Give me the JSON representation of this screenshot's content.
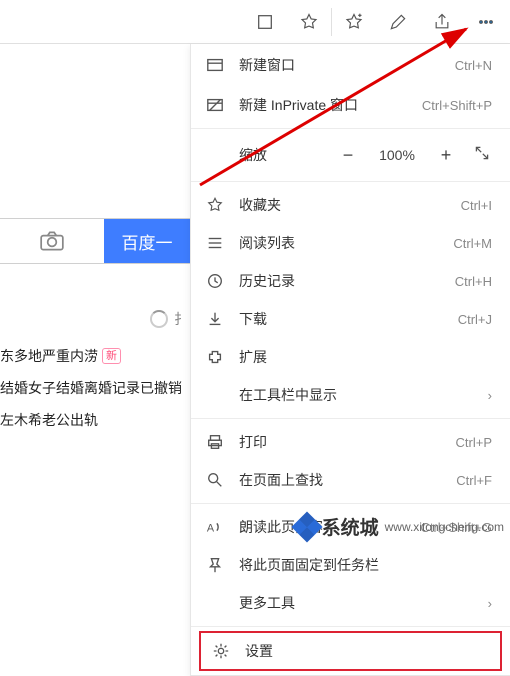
{
  "topbar": {
    "icons": [
      "square-icon",
      "star-outline-icon",
      "star-plus-icon",
      "pen-icon",
      "share-icon",
      "more-icon"
    ]
  },
  "search": {
    "button": "百度一"
  },
  "loading_fragment": "扌",
  "news": {
    "items": [
      {
        "text": "东多地严重内涝",
        "badge": "新"
      },
      {
        "text": "结婚女子结婚离婚记录已撤销"
      },
      {
        "text": "左木希老公出轨"
      }
    ]
  },
  "menu": {
    "new_window": {
      "label": "新建窗口",
      "shortcut": "Ctrl+N"
    },
    "new_inprivate": {
      "label": "新建 InPrivate 窗口",
      "shortcut": "Ctrl+Shift+P"
    },
    "zoom": {
      "label": "缩放",
      "value": "100%"
    },
    "favorites": {
      "label": "收藏夹",
      "shortcut": "Ctrl+I"
    },
    "readinglist": {
      "label": "阅读列表",
      "shortcut": "Ctrl+M"
    },
    "history": {
      "label": "历史记录",
      "shortcut": "Ctrl+H"
    },
    "downloads": {
      "label": "下载",
      "shortcut": "Ctrl+J"
    },
    "extensions": {
      "label": "扩展"
    },
    "show_in_toolbar": {
      "label": "在工具栏中显示"
    },
    "print": {
      "label": "打印",
      "shortcut": "Ctrl+P"
    },
    "find": {
      "label": "在页面上查找",
      "shortcut": "Ctrl+F"
    },
    "read_aloud": {
      "label": "朗读此页内容",
      "shortcut": "Ctrl+Shift+G"
    },
    "pin_taskbar": {
      "label": "将此页面固定到任务栏"
    },
    "more_tools": {
      "label": "更多工具"
    },
    "settings": {
      "label": "设置"
    }
  },
  "watermark": {
    "brand": "系统城",
    "domain": "www.xitongcheng.com"
  }
}
